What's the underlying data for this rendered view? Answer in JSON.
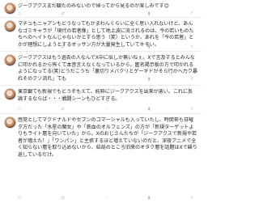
{
  "posts": [
    {
      "name": "",
      "text": "ジークアクスまだ観たのみないので帰ってから見るのが楽しみです😊"
    },
    {
      "name": "",
      "text": "マチュもニャアンもどうなってもかまわんくらいに全く思い入れないけど、あんなゴミキャラが「現代の若者像」として地上波に流されるのは、今の若いものたちへのヘイトなんじゃないかとすら思う（笑）というか、あれを「今の若者」とかが理想にしようとするオッサン方が大量発生していてキモい。"
    },
    {
      "name": "",
      "text": "ジークアクスはもう過去の人なんでX中に似しか無いねぇ。Xで言及するとみんなに叩かれるから怖くて本音言えなくなっているから、匿名掲示板の方で叩かれるようになってる(笑)どうだこうち「裏切りメバクリとゲーギドがそら行かへ力ク暴れそのクソ流れ」ても"
    },
    {
      "name": "",
      "text": "東京観ても新規でもどうぞもえて、純粋にジークアクスを出来が悪い。これに反論するならば・・・戦闘シーンもひどすぎる。"
    },
    {
      "name": "",
      "text": "感覚としてマクドナルドやセブンのコマーシャルも入っていたし、時間帯も日曜夕方だった「水星の魔女」や「鉄血のオルフェンズ」の方が「新規ターゲットよりもライト層を向いていた」から。Xのおじさんたちが「ジークアクスで新規や若者が増えた！」「ワンパン」と主張するほど増えていないのだと、深夜アニメで全く知らない層を取り込めないから、結局のところ旧来のオタク層を話題はXで繰り返しているだけ。"
    }
  ],
  "icons": [
    "reply-icon",
    "retweet-icon",
    "like-icon",
    "views-icon",
    "share-icon"
  ]
}
